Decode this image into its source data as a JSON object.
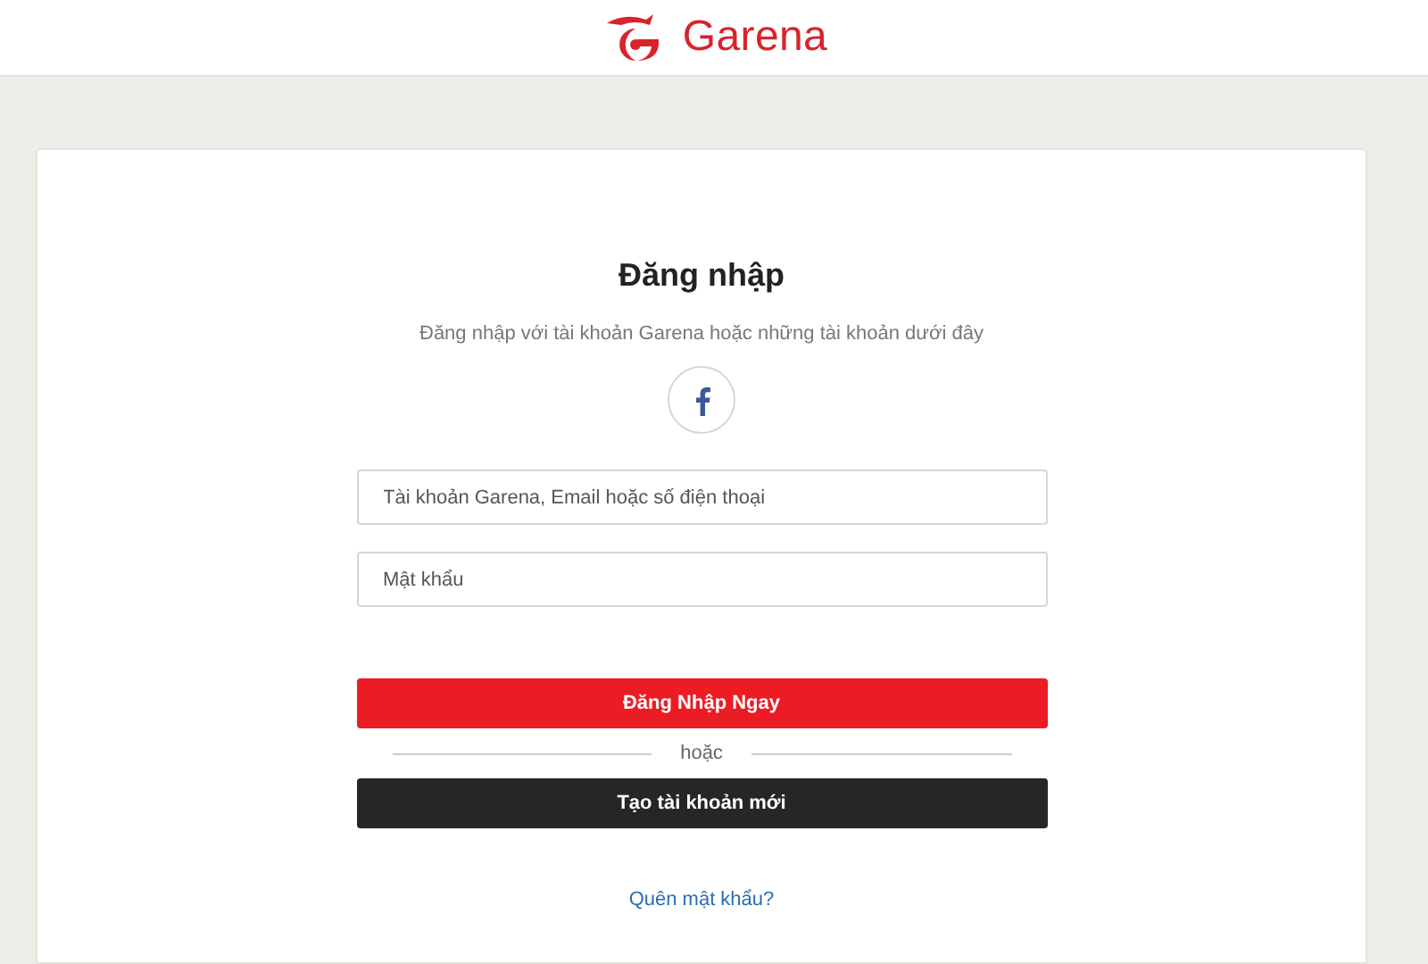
{
  "header": {
    "brand": "Garena"
  },
  "login": {
    "title": "Đăng nhập",
    "subtitle": "Đăng nhập với tài khoản Garena hoặc những tài khoản dưới đây",
    "fields": [
      {
        "placeholder": "Tài khoản Garena, Email hoặc số điện thoại"
      },
      {
        "placeholder": "Mật khẩu"
      }
    ],
    "login_button": "Đăng Nhập Ngay",
    "divider": "hoặc",
    "register_button": "Tạo tài khoản mới",
    "forgot_link": "Quên mật khẩu?"
  }
}
